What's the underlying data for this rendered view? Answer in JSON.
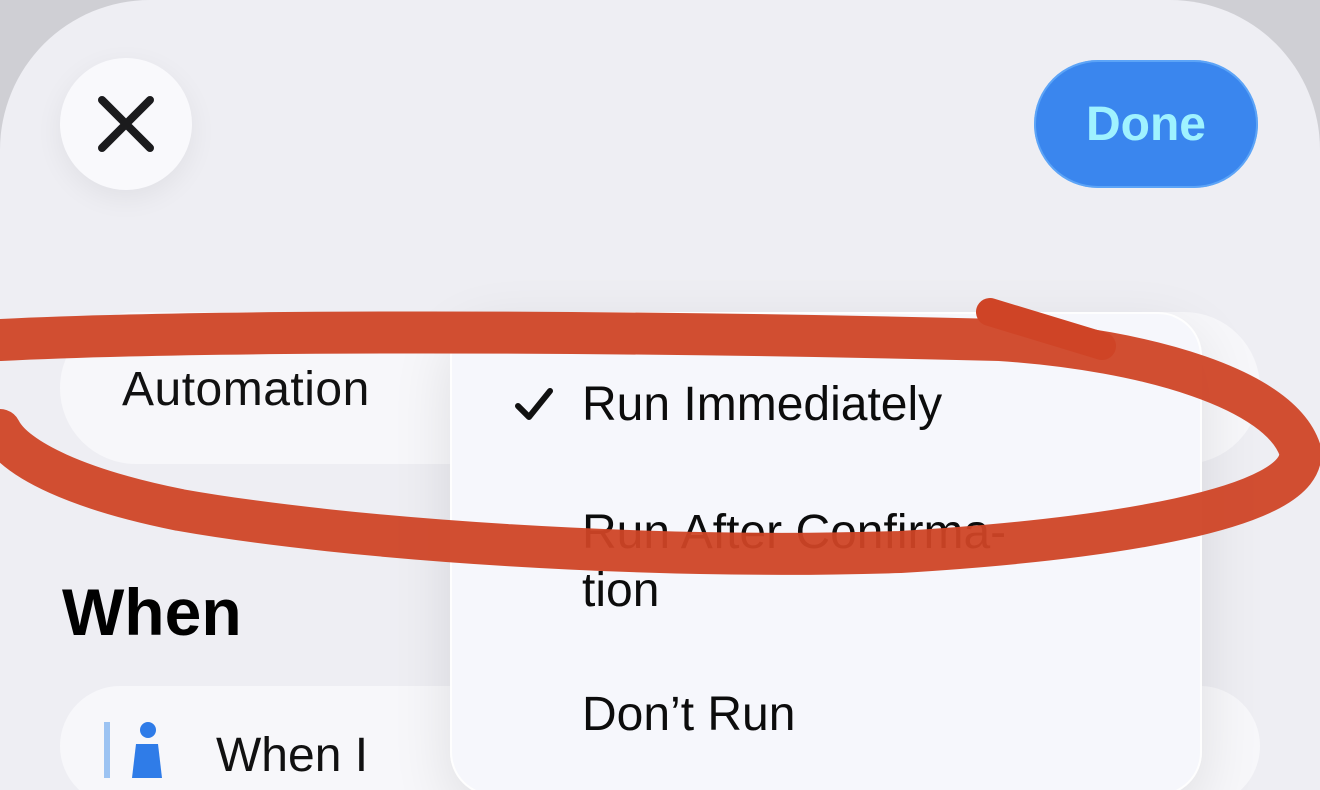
{
  "header": {
    "close_icon": "close-icon",
    "done_label": "Done"
  },
  "automation": {
    "label": "Automation",
    "menu": {
      "items": [
        {
          "label": "Run Immediately",
          "checked": true
        },
        {
          "label": "Run After Confirma-\ntion",
          "checked": false
        },
        {
          "label": "Don’t Run",
          "checked": false
        }
      ]
    }
  },
  "when": {
    "heading": "When",
    "first_trigger_label": "When I",
    "first_trigger_icon": "person-icon"
  },
  "colors": {
    "accent": "#3a86ee",
    "done_text": "#9ff2ff",
    "annotation_stroke": "#cf4426",
    "sheet_background": "#eeeef3"
  }
}
